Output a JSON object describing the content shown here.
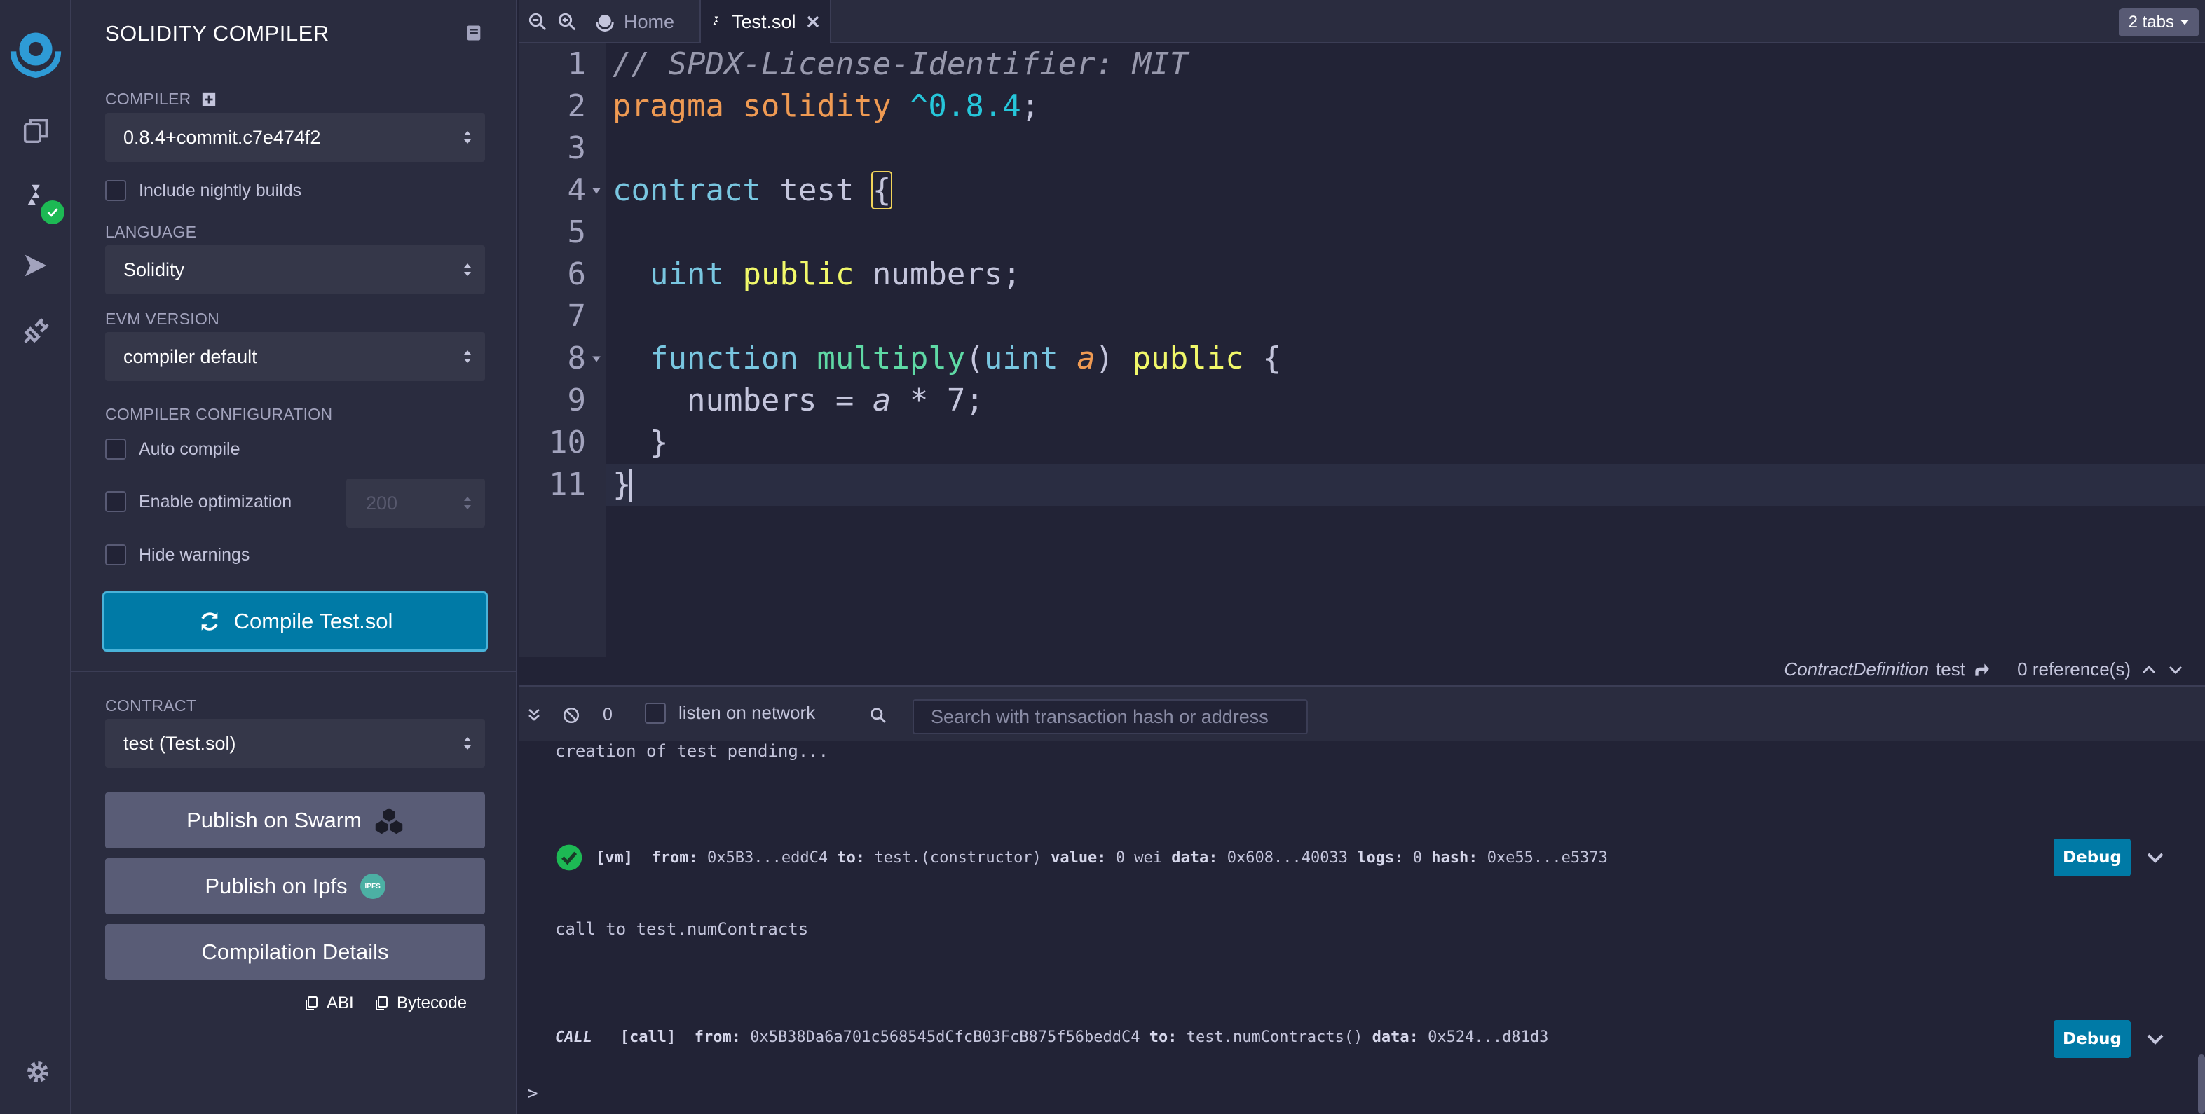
{
  "app": {
    "accent": "#007aa6",
    "success": "#1db954"
  },
  "rail": {
    "icons": [
      "remix-logo-icon",
      "file-explorer-icon",
      "solidity-compiler-icon",
      "deploy-run-icon",
      "plugin-manager-icon",
      "settings-gear-icon"
    ]
  },
  "panel": {
    "title": "SOLIDITY COMPILER",
    "compiler_label": "COMPILER",
    "compiler_value": "0.8.4+commit.c7e474f2",
    "nightly_label": "Include nightly builds",
    "language_label": "LANGUAGE",
    "language_value": "Solidity",
    "evm_label": "EVM VERSION",
    "evm_value": "compiler default",
    "config_label": "COMPILER CONFIGURATION",
    "auto_compile_label": "Auto compile",
    "optimization_label": "Enable optimization",
    "optimization_runs": "200",
    "hide_warnings_label": "Hide warnings",
    "compile_button": "Compile Test.sol",
    "contract_label": "CONTRACT",
    "contract_value": "test (Test.sol)",
    "swarm_button": "Publish on Swarm",
    "ipfs_button": "Publish on Ipfs",
    "ipfs_badge": "IPFS",
    "details_button": "Compilation Details",
    "abi_label": "ABI",
    "bytecode_label": "Bytecode"
  },
  "tabs": {
    "home": "Home",
    "active": "Test.sol",
    "count": "2 tabs"
  },
  "editor": {
    "line_numbers": [
      "1",
      "2",
      "3",
      "4",
      "5",
      "6",
      "7",
      "8",
      "9",
      "10",
      "11"
    ],
    "lines": {
      "l1": "// SPDX-License-Identifier: MIT",
      "l2_kw": "pragma solidity",
      "l2_ver": "^0.8.4",
      "l2_end": ";",
      "l4_kw": "contract",
      "l4_name": " test ",
      "l4_brace": "{",
      "l6_type": "uint",
      "l6_mod": "public",
      "l6_rest": " numbers;",
      "l8_kw": "function",
      "l8_fn": "multiply",
      "l8_open": "(",
      "l8_type": "uint",
      "l8_arg": "a",
      "l8_close": ")",
      "l8_mod": "public",
      "l8_brace": " {",
      "l9": "numbers = ",
      "l9_a": "a",
      "l9_rest": " * 7;",
      "l10": "}",
      "l11": "}"
    }
  },
  "context": {
    "kind": "ContractDefinition",
    "name": "test",
    "refs": "0 reference(s)"
  },
  "terminal": {
    "pending_count": "0",
    "listen_label": "listen on network",
    "search_placeholder": "Search with transaction hash or address",
    "pending_msg": "creation of test pending...",
    "tx1": {
      "tag": "[vm]",
      "from_k": "from:",
      "from_v": "0x5B3...eddC4",
      "to_k": "to:",
      "to_v": "test.(constructor)",
      "value_k": "value:",
      "value_v": "0 wei",
      "data_k": "data:",
      "data_v": "0x608...40033",
      "logs_k": "logs:",
      "logs_v": "0",
      "hash_k": "hash:",
      "hash_v": "0xe55...e5373"
    },
    "call_msg": "call to test.numContracts",
    "tx2": {
      "call": "CALL",
      "tag": "[call]",
      "from_k": "from:",
      "from_v": "0x5B38Da6a701c568545dCfcB03FcB875f56beddC4",
      "to_k": "to:",
      "to_v": "test.numContracts()",
      "data_k": "data:",
      "data_v": "0x524...d81d3"
    },
    "debug_label": "Debug",
    "prompt": ">"
  }
}
